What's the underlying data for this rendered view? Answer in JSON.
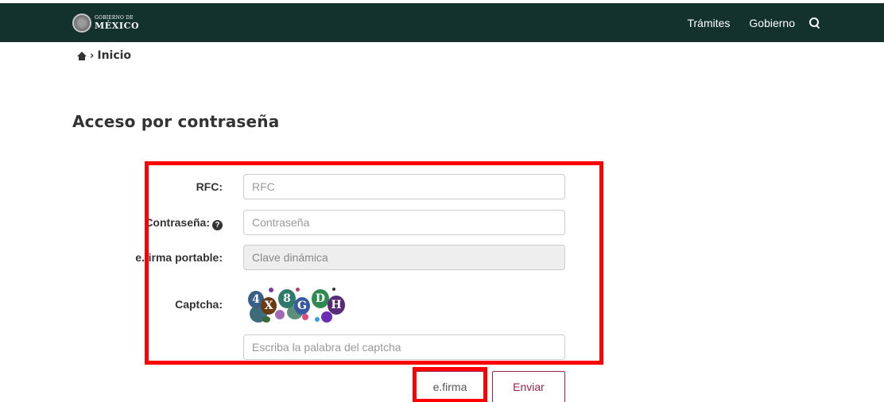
{
  "header": {
    "logo_small": "GOBIERNO DE",
    "logo_big": "MÉXICO",
    "nav": [
      {
        "label": "Trámites"
      },
      {
        "label": "Gobierno"
      }
    ],
    "icons": {
      "search": "search-icon",
      "seal": "seal-icon"
    },
    "background": "#13322b"
  },
  "breadcrumb": {
    "separator": "›",
    "current": "Inicio"
  },
  "page": {
    "title": "Acceso por contraseña"
  },
  "form": {
    "rfc": {
      "label": "RFC:",
      "placeholder": "RFC"
    },
    "password": {
      "label": "Contraseña:",
      "placeholder": "Contraseña",
      "help_icon": "question-circle-icon"
    },
    "efirma_portable": {
      "label": "e.firma portable:",
      "placeholder": "Clave dinámica"
    },
    "captcha": {
      "label": "Captcha:",
      "characters": [
        "4",
        "X",
        "8",
        "G",
        "D",
        "H"
      ],
      "input_placeholder": "Escriba la palabra del captcha"
    }
  },
  "buttons": {
    "efirma": "e.firma",
    "enviar": "Enviar"
  },
  "colors": {
    "accent": "#9d2449",
    "highlight": "#ff0000"
  }
}
